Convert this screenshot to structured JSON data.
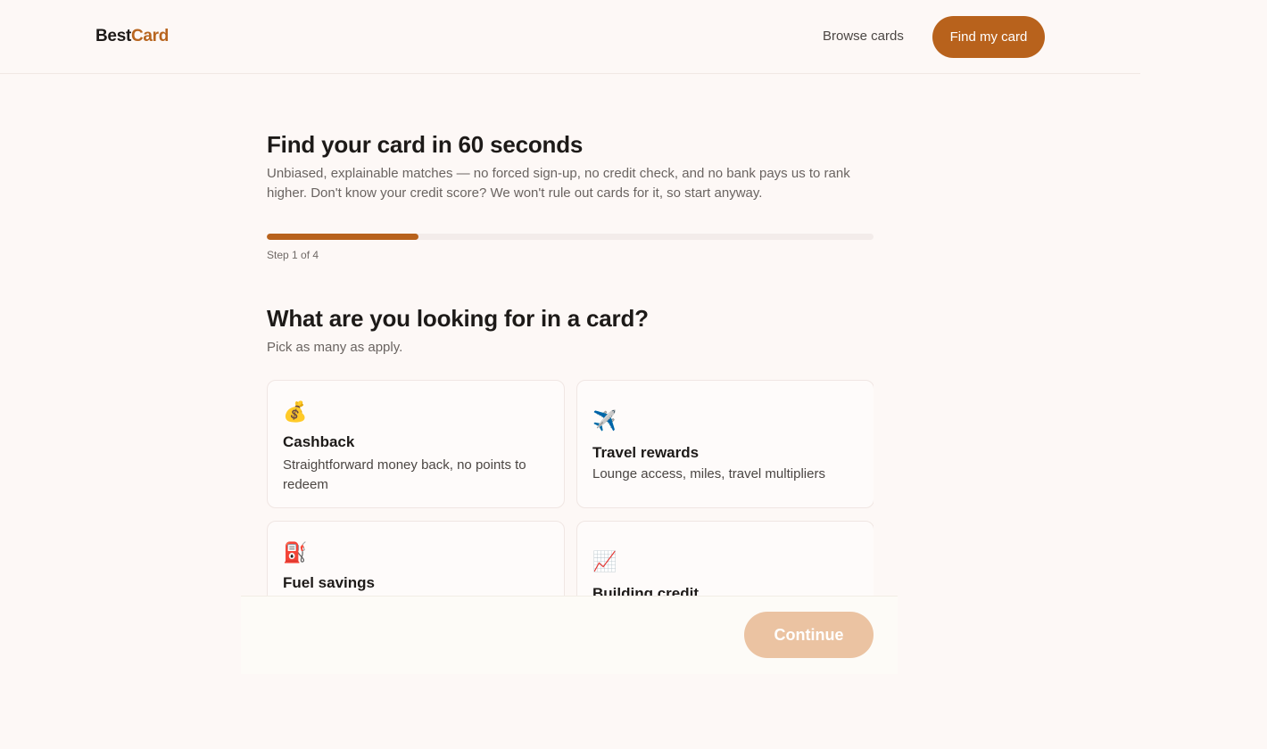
{
  "header": {
    "brand_main": "Best",
    "brand_accent": "Card",
    "browse_label": "Browse cards",
    "cta_label": "Find my card"
  },
  "intro": {
    "title": "Find your card in 60 seconds",
    "subtitle": "Unbiased, explainable matches — no forced sign-up, no credit check, and no bank pays us to rank higher. Don't know your credit score? We won't rule out cards for it, so start anyway."
  },
  "progress": {
    "current_step": 1,
    "total_steps": 4,
    "step_label": "Step 1 of 4",
    "fraction": 0.25
  },
  "question": {
    "title": "What are you looking for in a card?",
    "hint": "Pick as many as apply."
  },
  "options": [
    {
      "icon": "money-bag-icon",
      "glyph": "💰",
      "title": "Cashback",
      "description": "Straightforward money back, no points to redeem"
    },
    {
      "icon": "airplane-icon",
      "glyph": "✈️",
      "title": "Travel rewards",
      "description": "Lounge access, miles, travel multipliers"
    },
    {
      "icon": "fuel-pump-icon",
      "glyph": "⛽",
      "title": "Fuel savings",
      "description": ""
    },
    {
      "icon": "chart-increasing-icon",
      "glyph": "📈",
      "title": "Building credit",
      "description": ""
    }
  ],
  "footer": {
    "continue_label": "Continue",
    "continue_enabled": false
  },
  "colors": {
    "accent": "#b8621c",
    "accent_disabled": "#ebc3a2",
    "background": "#fdf8f6",
    "text": "#1d1a18",
    "muted_text": "#6a6461"
  }
}
